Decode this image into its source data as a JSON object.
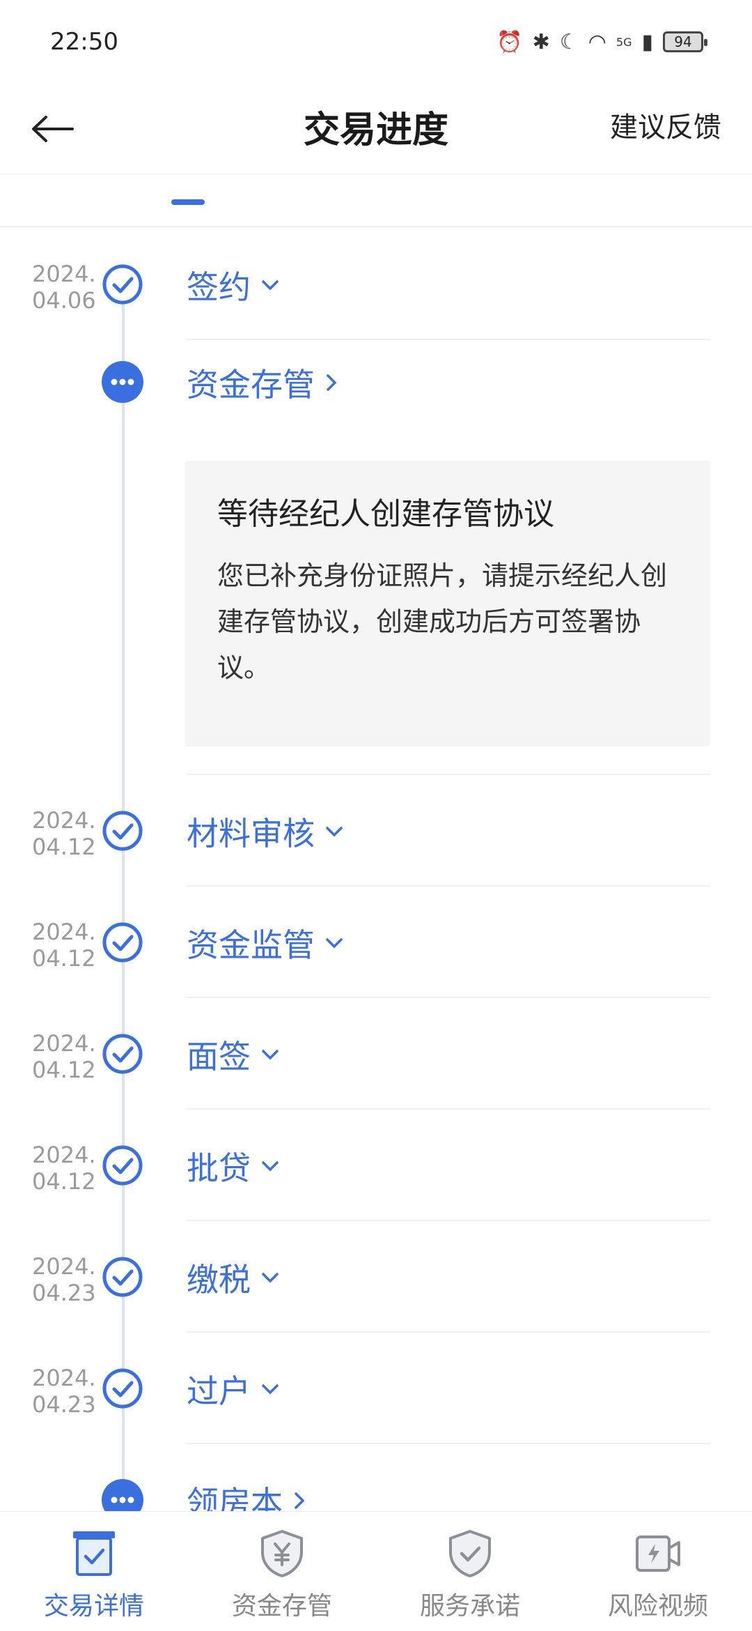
{
  "status_bar": {
    "time": "22:50",
    "network": "5G",
    "battery": "94"
  },
  "header": {
    "title": "交易进度",
    "feedback_label": "建议反馈"
  },
  "steps": [
    {
      "date": "2024.\n04.06",
      "label": "签约",
      "state": "done",
      "expand": "down"
    },
    {
      "date": "",
      "label": "资金存管",
      "state": "pending",
      "expand": "right"
    },
    {
      "date": "2024.\n04.12",
      "label": "材料审核",
      "state": "done",
      "expand": "down"
    },
    {
      "date": "2024.\n04.12",
      "label": "资金监管",
      "state": "done",
      "expand": "down"
    },
    {
      "date": "2024.\n04.12",
      "label": "面签",
      "state": "done",
      "expand": "down"
    },
    {
      "date": "2024.\n04.12",
      "label": "批贷",
      "state": "done",
      "expand": "down"
    },
    {
      "date": "2024.\n04.23",
      "label": "缴税",
      "state": "done",
      "expand": "down"
    },
    {
      "date": "2024.\n04.23",
      "label": "过户",
      "state": "done",
      "expand": "down"
    },
    {
      "date": "",
      "label": "领房本",
      "state": "pending",
      "expand": "right"
    }
  ],
  "info_card": {
    "title": "等待经纪人创建存管协议",
    "text": "您已补充身份证照片，请提示经纪人创建存管协议，创建成功后方可签署协议。"
  },
  "bottom_nav": [
    {
      "label": "交易详情",
      "icon": "clipboard-check-icon",
      "active": true
    },
    {
      "label": "资金存管",
      "icon": "yuan-shield-icon",
      "active": false
    },
    {
      "label": "服务承诺",
      "icon": "check-shield-icon",
      "active": false
    },
    {
      "label": "风险视频",
      "icon": "video-bolt-icon",
      "active": false
    }
  ],
  "colors": {
    "accent": "#3a6fe0",
    "muted": "#9a9a9a",
    "line": "#dde3ee"
  }
}
